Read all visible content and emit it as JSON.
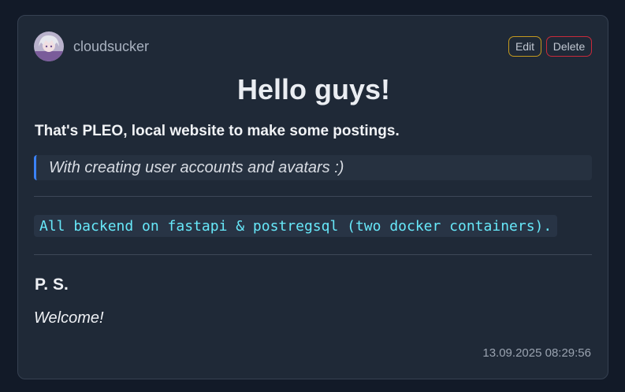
{
  "post": {
    "author": "cloudsucker",
    "actions": {
      "edit_label": "Edit",
      "delete_label": "Delete"
    },
    "title": "Hello guys!",
    "subtitle": "That's PLEO, local website to make some postings.",
    "quote": "With creating user accounts and avatars :)",
    "code": "All backend on fastapi & postregsql (two docker containers).",
    "ps_heading": "P. S.",
    "closing": "Welcome!",
    "timestamp": "13.09.2025 08:29:56"
  },
  "colors": {
    "page_background": "#121a28",
    "card_background": "#1f2937",
    "edit_border": "#c49a1e",
    "delete_border": "#c92a3b",
    "quote_accent": "#3b82f6",
    "code_text": "#67e8f9"
  }
}
